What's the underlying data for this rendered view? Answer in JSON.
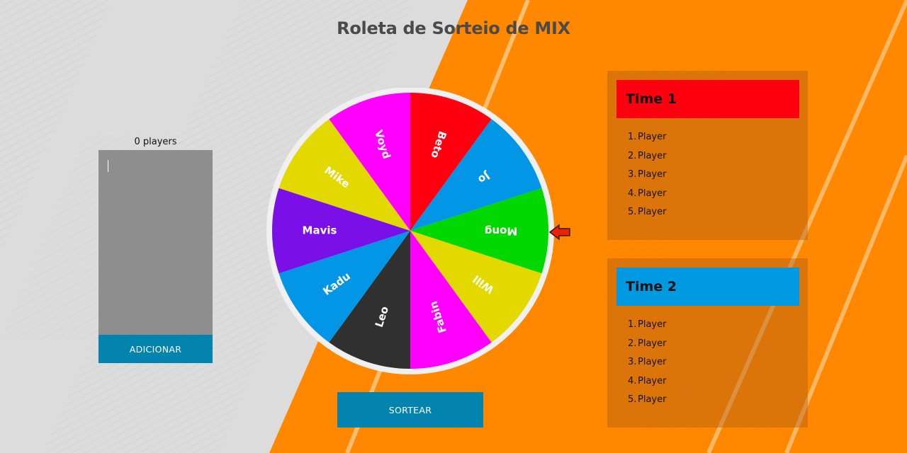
{
  "title": "Roleta de Sorteio de MIX",
  "player_count": "0 players",
  "names_input": {
    "value": "",
    "placeholder": ""
  },
  "add_button": "ADICIONAR",
  "draw_button": "SORTEAR",
  "wheel": {
    "segments": [
      {
        "name": "Beto",
        "color": "#ff0010"
      },
      {
        "name": "Jo",
        "color": "#0396e6"
      },
      {
        "name": "Mong",
        "color": "#00d800"
      },
      {
        "name": "Will",
        "color": "#e3d900"
      },
      {
        "name": "Fabin",
        "color": "#ff00ff"
      },
      {
        "name": "Leo",
        "color": "#303030"
      },
      {
        "name": "Kadu",
        "color": "#0396e6"
      },
      {
        "name": "Mavis",
        "color": "#7b0fe8"
      },
      {
        "name": "Mike",
        "color": "#e3d900"
      },
      {
        "name": "Voyd",
        "color": "#ff00ff"
      }
    ],
    "pointer_icon": "arrow-left-icon",
    "pointer_color": "#e8220e"
  },
  "teams": [
    {
      "name": "Time 1",
      "color": "#ff0010",
      "players": [
        "Player",
        "Player",
        "Player",
        "Player",
        "Player"
      ]
    },
    {
      "name": "Time 2",
      "color": "#0299e3",
      "players": [
        "Player",
        "Player",
        "Player",
        "Player",
        "Player"
      ]
    }
  ],
  "colors": {
    "orange": "#ff8800",
    "button": "#0284af"
  }
}
